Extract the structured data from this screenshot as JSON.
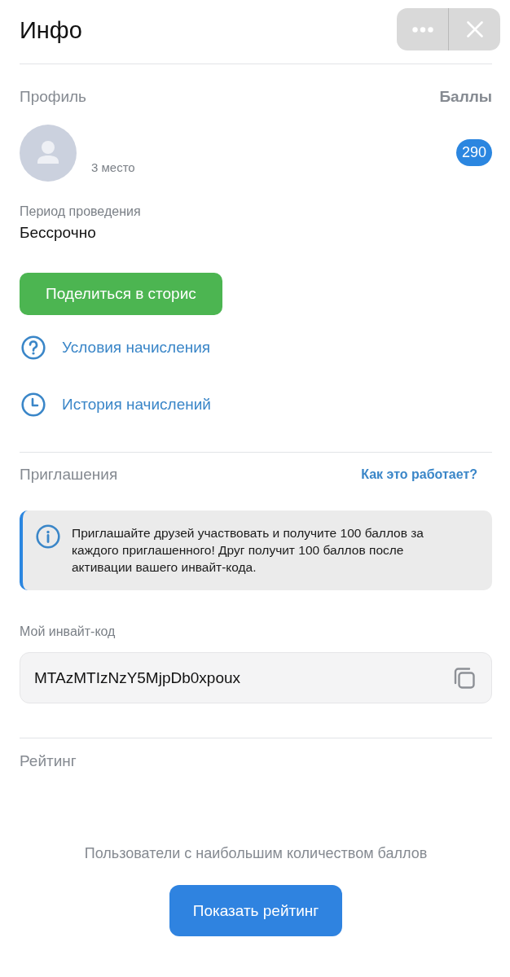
{
  "header": {
    "title": "Инфо"
  },
  "profile": {
    "heading": "Профиль",
    "points_heading": "Баллы",
    "rank": "3 место",
    "points": "290"
  },
  "period": {
    "label": "Период проведения",
    "value": "Бессрочно"
  },
  "share_button": "Поделиться в сторис",
  "links": [
    {
      "kind": "help",
      "label": "Условия начисления"
    },
    {
      "kind": "history",
      "label": "История начислений"
    }
  ],
  "invitations": {
    "heading": "Приглашения",
    "help_link": "Как это работает?",
    "info": "Приглашайте друзей участвовать и получите 100 баллов за каждого приглашенного! Друг получит 100 баллов после активации вашего инвайт-кода.",
    "code_label": "Мой инвайт-код",
    "code": "MTAzMTIzNzY5MjpDb0xpoux"
  },
  "rating": {
    "heading": "Рейтинг",
    "description": "Пользователи с наибольшим количеством баллов",
    "button": "Показать рейтинг"
  }
}
